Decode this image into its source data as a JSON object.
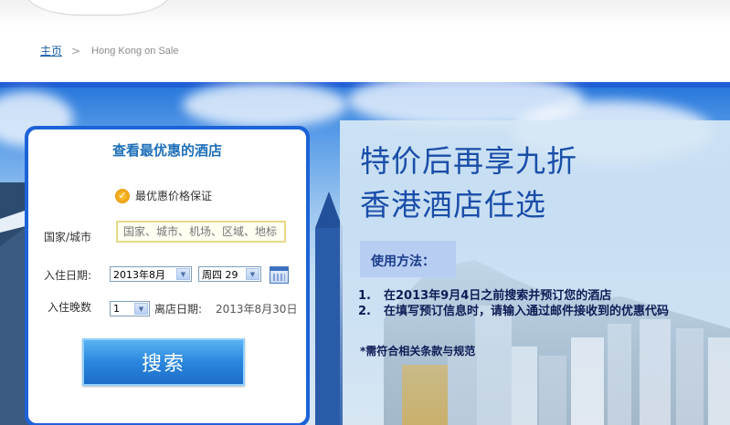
{
  "breadcrumb": {
    "home": "主页",
    "separator": ">",
    "current": "Hong Kong on Sale"
  },
  "search": {
    "title": "查看最优惠的酒店",
    "guarantee": "最优惠价格保证",
    "destination_label": "国家/城市",
    "destination_placeholder": "国家、城市、机场、区域、地标",
    "checkin_label": "入住日期:",
    "checkin_month": "2013年8月",
    "checkin_day": "周四 29",
    "nights_label": "入住晚数",
    "nights_value": "1",
    "checkout_label": "离店日期:",
    "checkout_value": "2013年8月30日",
    "button": "搜索"
  },
  "promo": {
    "title_line1": "特价后再享九折",
    "title_line2": "香港酒店任选",
    "how_to": "使用方法：",
    "steps": [
      {
        "num": "1.",
        "text": "在2013年9月4日之前搜索并预订您的酒店"
      },
      {
        "num": "2.",
        "text": "在填写预订信息时，请输入通过邮件接收到的优惠代码"
      }
    ],
    "terms": "*需符合相关条款与规范"
  },
  "colors": {
    "accent": "#1c63d8",
    "title": "#1a4ea8",
    "link": "#1a5ea8"
  },
  "icons": {
    "guarantee": "check-badge-icon",
    "calendar": "calendar-icon"
  }
}
